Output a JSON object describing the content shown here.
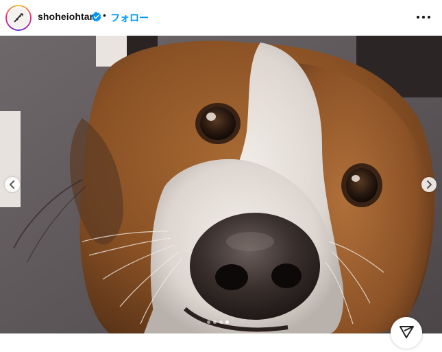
{
  "post": {
    "username": "shoheiohtani",
    "separator": "•",
    "follow_label": "フォロー",
    "verified": true
  },
  "carousel": {
    "slide_count": 4,
    "active_index": 3
  },
  "colors": {
    "accent": "#0095f6",
    "verified_badge": "#0095f6"
  },
  "icons": {
    "avatar": "avatar-image",
    "verified": "verified-badge-icon",
    "more": "more-options-icon",
    "prev": "chevron-left-icon",
    "next": "chevron-right-icon",
    "share": "share-icon"
  }
}
